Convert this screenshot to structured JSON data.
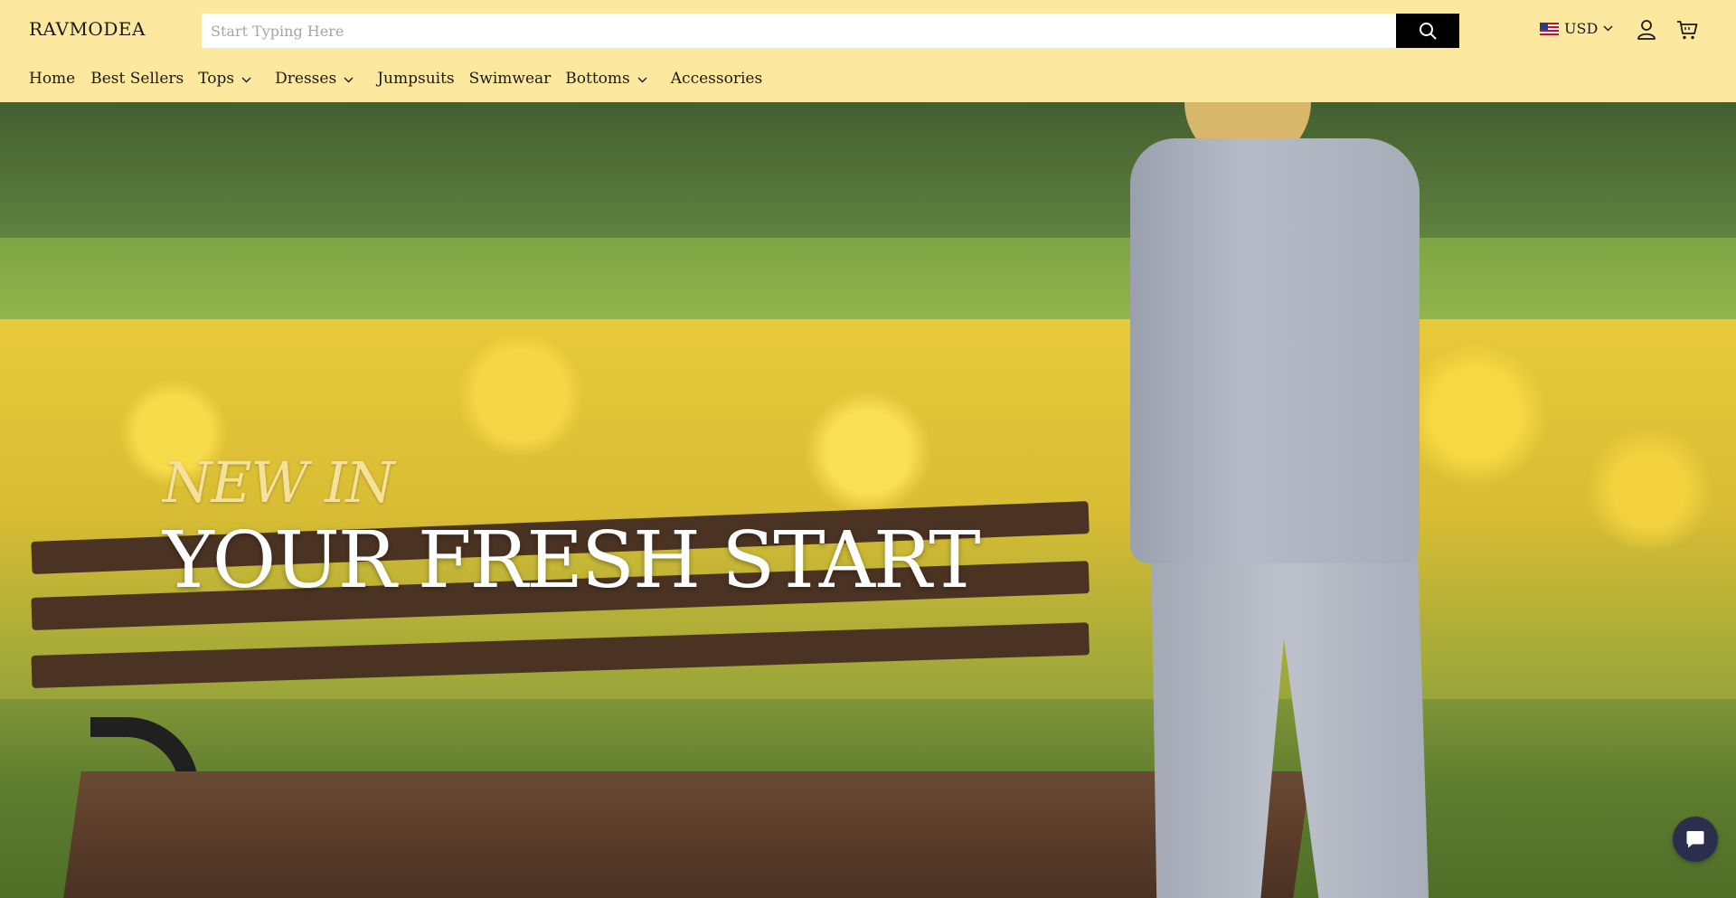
{
  "header": {
    "logo": "RAVMODEA",
    "search": {
      "placeholder": "Start Typing Here",
      "value": ""
    },
    "currency": "USD"
  },
  "nav": {
    "items": [
      {
        "label": "Home",
        "has_dropdown": false
      },
      {
        "label": "Best Sellers",
        "has_dropdown": false
      },
      {
        "label": "Tops",
        "has_dropdown": true
      },
      {
        "label": "Dresses",
        "has_dropdown": true
      },
      {
        "label": "Jumpsuits",
        "has_dropdown": false
      },
      {
        "label": "Swimwear",
        "has_dropdown": false
      },
      {
        "label": "Bottoms",
        "has_dropdown": true
      },
      {
        "label": "Accessories",
        "has_dropdown": false
      }
    ]
  },
  "hero": {
    "kicker": "NEW IN",
    "title": "YOUR FRESH START"
  },
  "icons": {
    "search": "search-icon",
    "flag": "us-flag-icon",
    "currency_dropdown": "chevron-down-icon",
    "account": "user-icon",
    "cart": "cart-icon",
    "chat": "chat-icon"
  },
  "colors": {
    "header_bg": "#fde8a0",
    "search_button": "#000000",
    "hero_kicker": "#f5e29a",
    "hero_title": "#ffffff",
    "chat_button": "#2b2f4e"
  }
}
